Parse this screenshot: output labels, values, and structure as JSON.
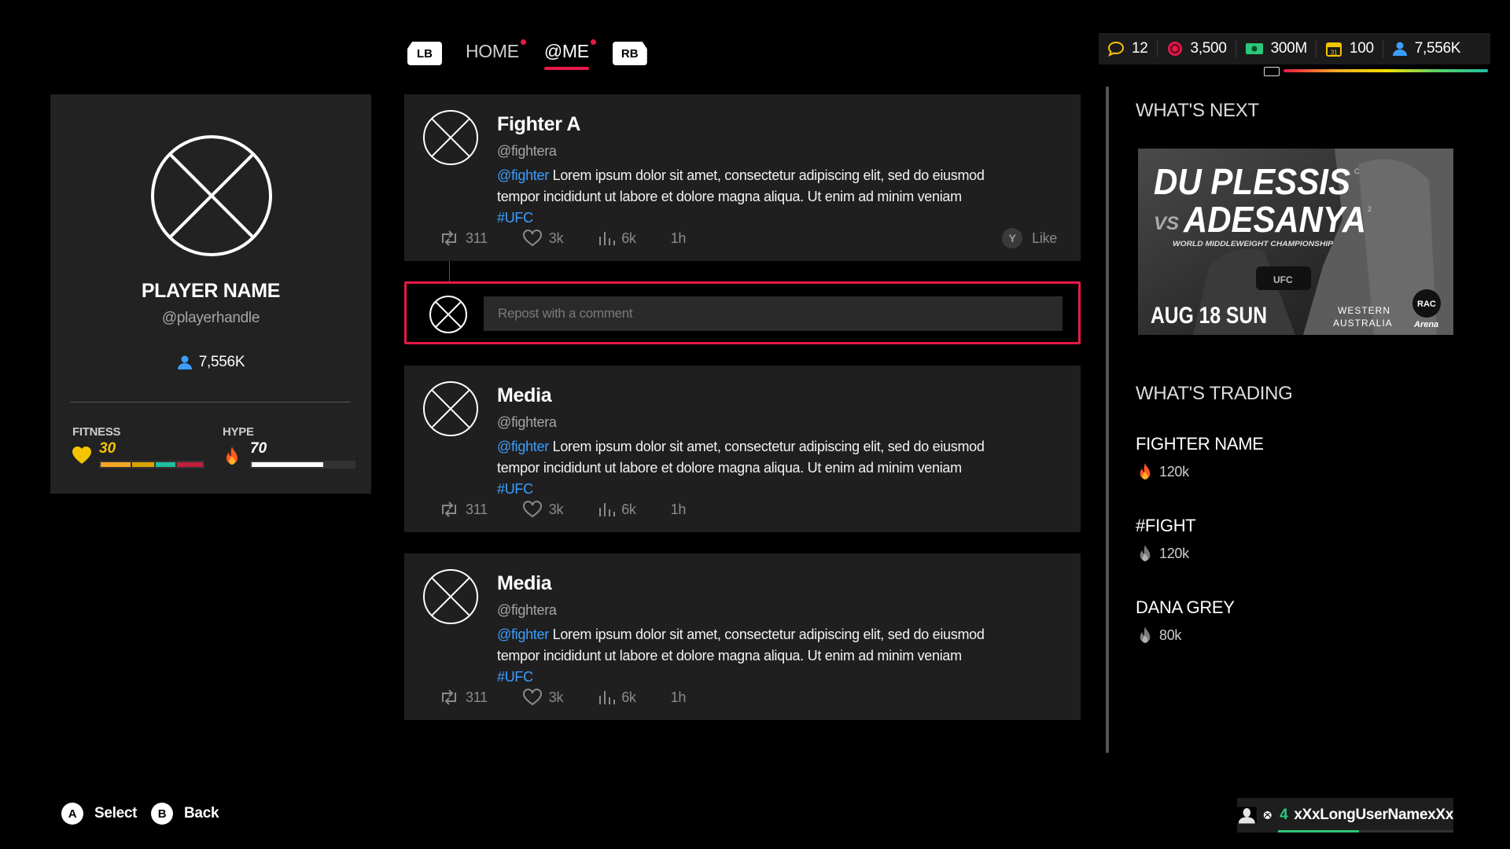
{
  "nav": {
    "lb": "LB",
    "rb": "RB",
    "tabs": [
      {
        "label": "HOME",
        "active": false,
        "notify": true
      },
      {
        "label": "@ME",
        "active": true,
        "notify": true
      }
    ]
  },
  "currency": {
    "messages": "12",
    "coins": "3,500",
    "cash": "300M",
    "days": "100",
    "calendar_day": "31",
    "followers": "7,556K"
  },
  "profile": {
    "name": "PLAYER NAME",
    "handle": "@playerhandle",
    "followers": "7,556K",
    "fitness_label": "FITNESS",
    "fitness_value": "30",
    "hype_label": "HYPE",
    "hype_value": "70"
  },
  "posts": [
    {
      "name": "Fighter A",
      "handle": "@fightera",
      "mention": "@fighter",
      "text": " Lorem ipsum dolor sit amet, consectetur adipiscing elit, sed do eiusmod tempor incididunt ut labore et dolore magna aliqua. Ut enim ad minim veniam ",
      "hashtag": "#UFC",
      "reposts": "311",
      "likes": "3k",
      "views": "6k",
      "time": "1h",
      "like_button": "Y",
      "like_label": "Like"
    },
    {
      "name": "Media",
      "handle": "@fightera",
      "mention": "@fighter",
      "text": " Lorem ipsum dolor sit amet, consectetur adipiscing elit, sed do eiusmod tempor incididunt ut labore et dolore magna aliqua. Ut enim ad minim veniam ",
      "hashtag": "#UFC",
      "reposts": "311",
      "likes": "3k",
      "views": "6k",
      "time": "1h"
    },
    {
      "name": "Media",
      "handle": "@fightera",
      "mention": "@fighter",
      "text": " Lorem ipsum dolor sit amet, consectetur adipiscing elit, sed do eiusmod tempor incididunt ut labore et dolore magna aliqua. Ut enim ad minim veniam ",
      "hashtag": "#UFC",
      "reposts": "311",
      "likes": "3k",
      "views": "6k",
      "time": "1h"
    }
  ],
  "repost": {
    "placeholder": "Repost with a comment"
  },
  "whats_next": {
    "title": "WHAT'S NEXT",
    "fighter1": "DU PLESSIS",
    "vs": "VS",
    "fighter2": "ADESANYA",
    "subtitle": "WORLD MIDDLEWEIGHT CHAMPIONSHIP",
    "date": "AUG 18 SUN",
    "location_line1": "WESTERN",
    "location_line2": "AUSTRALIA",
    "venue_line1": "RAC",
    "venue_line2": "Arena",
    "belt": "UFC",
    "rank1": "C",
    "rank2": "2"
  },
  "whats_trading": {
    "title": "WHAT'S TRADING",
    "items": [
      {
        "name": "FIGHTER NAME",
        "value": "120k",
        "hot": true
      },
      {
        "name": "#FIGHT",
        "value": "120k",
        "hot": false
      },
      {
        "name": "DANA GREY",
        "value": "80k",
        "hot": false
      }
    ]
  },
  "hints": {
    "a_btn": "A",
    "a_label": "Select",
    "b_btn": "B",
    "b_label": "Back"
  },
  "user": {
    "level": "4",
    "gamertag": "xXxLongUserNamexXx"
  },
  "colors": {
    "accent": "#e8194a",
    "link": "#3c9eff",
    "fitness": "#f5c400",
    "hype": "#ff5a1f"
  }
}
